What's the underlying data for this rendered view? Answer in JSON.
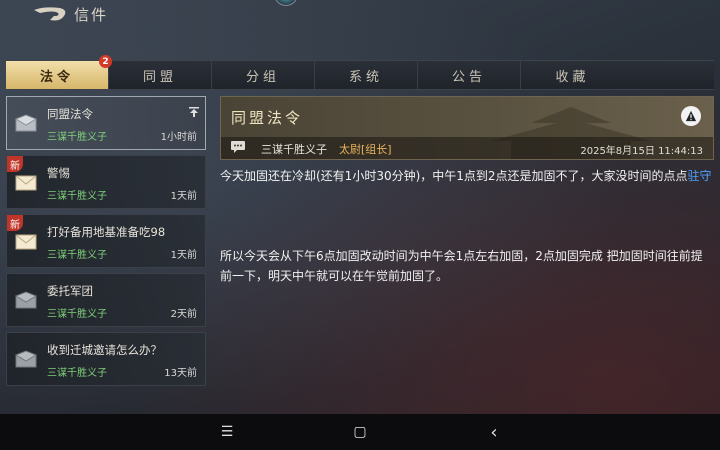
{
  "header": {
    "title": "信件"
  },
  "tabs": [
    {
      "label": "法令",
      "badge": "2"
    },
    {
      "label": "同盟"
    },
    {
      "label": "分组"
    },
    {
      "label": "系统"
    },
    {
      "label": "公告"
    },
    {
      "label": "收藏"
    }
  ],
  "mails": [
    {
      "subject": "同盟法令",
      "sender": "三谋千胜义子",
      "time": "1小时前",
      "new_tag": ""
    },
    {
      "subject": "警惕",
      "sender": "三谋千胜义子",
      "time": "1天前",
      "new_tag": "新"
    },
    {
      "subject": "打好备用地基准备吃98",
      "sender": "三谋千胜义子",
      "time": "1天前",
      "new_tag": "新"
    },
    {
      "subject": "委托军团",
      "sender": "三谋千胜义子",
      "time": "2天前",
      "new_tag": ""
    },
    {
      "subject": "收到迁城邀请怎么办？",
      "sender": "三谋千胜义子",
      "time": "13天前",
      "new_tag": ""
    }
  ],
  "detail": {
    "title": "同盟法令",
    "sender": "三谋千胜义子",
    "rank": "太尉[组长]",
    "date": "2025年8月15日 11:44:13",
    "para1_text": "今天加固还在冷却(还有1小时30分钟)，中午1点到2点还是加固不了，大家没时间的点点",
    "para1_link": "驻守",
    "para2": "所以今天会从下午6点加固改动时间为中午会1点左右加固，2点加固完成 把加固时间往前提前一下，明天中午就可以在午觉前加固了。"
  },
  "navbar": {
    "menu": "☰",
    "home": "▢",
    "back": "‹"
  },
  "colors": {
    "active_tab": "#e6cc88",
    "sender_green": "#7fd07a",
    "rank_gold": "#e7b35a",
    "link_blue": "#4fa3ff",
    "new_tag_red": "#c0352a"
  }
}
